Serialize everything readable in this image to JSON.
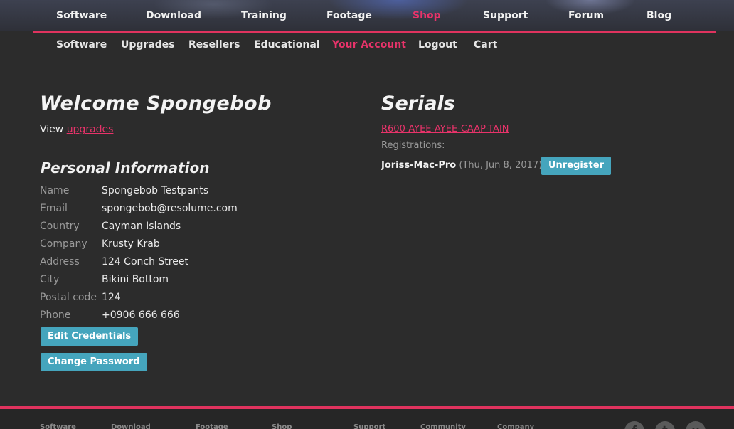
{
  "main_nav": {
    "items": [
      {
        "label": "Software"
      },
      {
        "label": "Download"
      },
      {
        "label": "Training"
      },
      {
        "label": "Footage"
      },
      {
        "label": "Shop",
        "active": true
      },
      {
        "label": "Support"
      },
      {
        "label": "Forum"
      },
      {
        "label": "Blog"
      }
    ]
  },
  "sub_nav": {
    "items": [
      {
        "label": "Software"
      },
      {
        "label": "Upgrades"
      },
      {
        "label": "Resellers"
      },
      {
        "label": "Educational"
      },
      {
        "label": "Your Account",
        "active": true
      },
      {
        "label": "Logout"
      },
      {
        "label": "Cart"
      }
    ]
  },
  "welcome": {
    "title": "Welcome Spongebob",
    "view_prefix": "View",
    "view_link": "upgrades"
  },
  "personal": {
    "title": "Personal Information",
    "fields": [
      {
        "label": "Name",
        "value": "Spongebob Testpants"
      },
      {
        "label": "Email",
        "value": "spongebob@resolume.com"
      },
      {
        "label": "Country",
        "value": "Cayman Islands"
      },
      {
        "label": "Company",
        "value": "Krusty Krab"
      },
      {
        "label": "Address",
        "value": "124 Conch Street"
      },
      {
        "label": "City",
        "value": "Bikini Bottom"
      },
      {
        "label": "Postal code",
        "value": "124"
      },
      {
        "label": "Phone",
        "value": "+0906 666 666"
      }
    ],
    "edit_button": "Edit Credentials",
    "password_button": "Change Password"
  },
  "serials": {
    "title": "Serials",
    "key": "R600-AYEE-AYEE-CAAP-TAIN",
    "registrations_label": "Registrations:",
    "machine_name": "Joriss-Mac-Pro",
    "machine_date": "(Thu, Jun 8, 2017)",
    "unregister_button": "Unregister"
  },
  "footer": {
    "items": [
      "Software",
      "Download",
      "Footage",
      "Shop",
      "Support",
      "Community",
      "Company"
    ],
    "social_icons": [
      "facebook-icon",
      "twitter-icon",
      "vimeo-icon"
    ]
  },
  "colors": {
    "accent": "#e8336a",
    "button": "#45a5bd",
    "background": "#2c2c2c"
  }
}
